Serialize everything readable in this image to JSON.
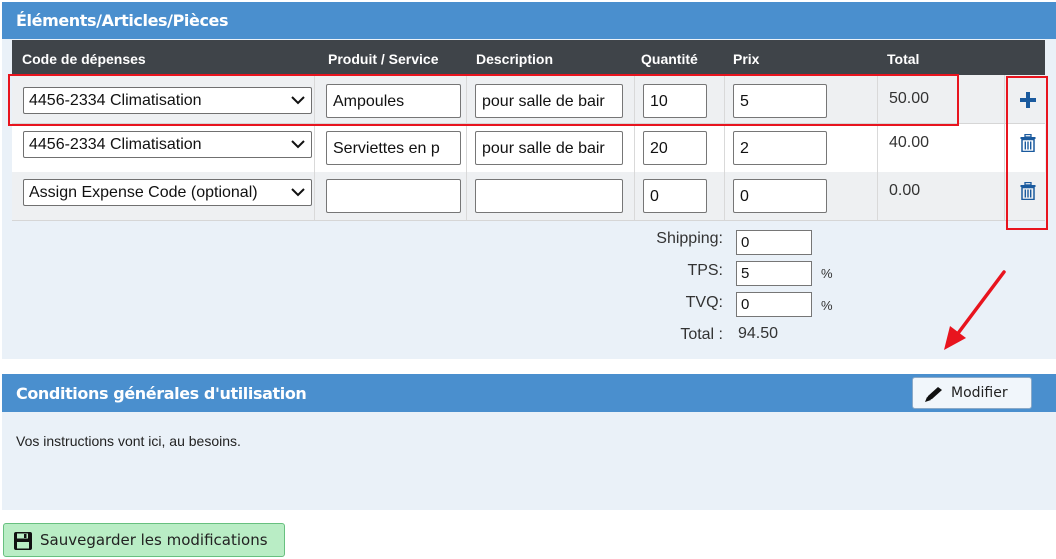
{
  "items_section": {
    "title": "Éléments/Articles/Pièces",
    "columns": [
      "Code de dépenses",
      "Produit / Service",
      "Description",
      "Quantité",
      "Prix",
      "Total"
    ],
    "rows": [
      {
        "code": "4456-2334 Climatisation",
        "product": "Ampoules",
        "description": "pour salle de bair",
        "quantity": "10",
        "price": "5",
        "total": "50.00",
        "action_icon": "plus-icon"
      },
      {
        "code": "4456-2334 Climatisation",
        "product": "Serviettes en p",
        "description": "pour salle de bair",
        "quantity": "20",
        "price": "2",
        "total": "40.00",
        "action_icon": "trash-icon"
      },
      {
        "code": "Assign Expense Code (optional)",
        "product": "",
        "description": "",
        "quantity": "0",
        "price": "0",
        "total": "0.00",
        "action_icon": "trash-icon"
      }
    ],
    "summary": {
      "shipping_label": "Shipping:",
      "shipping_value": "0",
      "tps_label": "TPS:",
      "tps_value": "5",
      "tps_unit": "%",
      "tvq_label": "TVQ:",
      "tvq_value": "0",
      "tvq_unit": "%",
      "total_label": "Total :",
      "total_value": "94.50"
    }
  },
  "terms_section": {
    "title": "Conditions générales d'utilisation",
    "modify_label": "Modifier",
    "text": "Vos instructions vont ici, au besoins."
  },
  "save_button": {
    "label": "Sauvegarder les modifications",
    "icon": "floppy-disk-icon"
  },
  "colors": {
    "header_blue": "#4a8fce",
    "table_header": "#3f4449",
    "panel_bg": "#eaf1f8",
    "annotation_red": "#e8141e",
    "save_green": "#b9edc5"
  },
  "annotations": [
    "red-box-first-row",
    "red-box-action-icons",
    "red-arrow"
  ]
}
